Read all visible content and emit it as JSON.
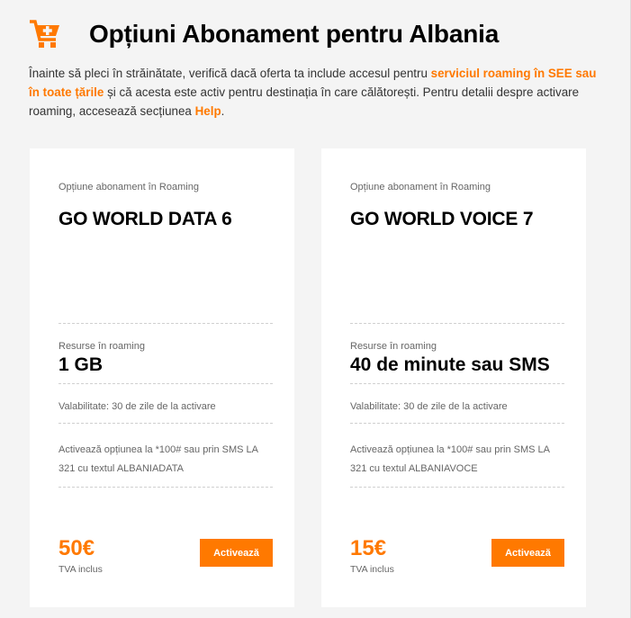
{
  "header": {
    "title": "Opțiuni Abonament pentru Albania",
    "icon": "cart-plus-icon",
    "icon_color": "#ff7900"
  },
  "intro": {
    "text_1": "Înainte să pleci în străinătate, verifică dacă oferta ta include accesul pentru ",
    "link_1": "serviciul roaming în SEE sau în toate țările",
    "text_2": " și că acesta este activ pentru destinația în care călătorești. Pentru detalii despre activare roaming, accesează secțiunea ",
    "link_2": "Help",
    "text_3": "."
  },
  "cards": [
    {
      "label": "Opțiune abonament în Roaming",
      "name": "GO WORLD DATA 6",
      "resources_label": "Resurse în roaming",
      "resources_value": "1 GB",
      "validity": "Valabilitate: 30 de zile de la activare",
      "activation": "Activează opțiunea la *100# sau prin SMS LA 321 cu textul ALBANIADATA",
      "price": "50€",
      "vat": "TVA inclus",
      "button": "Activează"
    },
    {
      "label": "Opțiune abonament în Roaming",
      "name": "GO WORLD VOICE 7",
      "resources_label": "Resurse în roaming",
      "resources_value": "40 de minute sau SMS",
      "validity": "Valabilitate: 30 de zile de la activare",
      "activation": "Activează opțiunea la *100# sau prin SMS LA 321 cu textul ALBANIAVOCE",
      "price": "15€",
      "vat": "TVA inclus",
      "button": "Activează"
    }
  ],
  "colors": {
    "accent": "#ff7900",
    "background": "#f4f4f4",
    "card": "#ffffff"
  }
}
